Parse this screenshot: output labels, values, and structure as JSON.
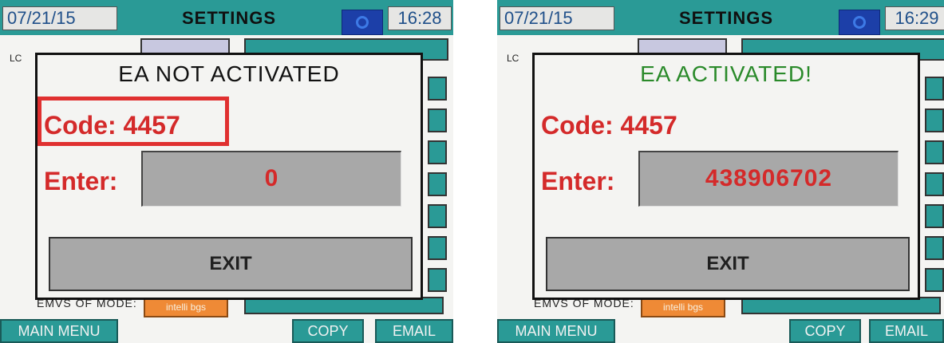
{
  "panels": [
    {
      "date": "07/21/15",
      "title": "SETTINGS",
      "time": "16:28",
      "dialog": {
        "status": "EA NOT ACTIVATED",
        "status_color": "#111111",
        "code_label": "Code: 4457",
        "enter_label": "Enter:",
        "enter_value": "0",
        "exit_label": "EXIT",
        "highlight": true
      },
      "background": {
        "mode_label": "EMVS OF MODE:",
        "mode_value": "intelli bgs"
      },
      "footer": {
        "main_menu": "MAIN MENU",
        "copy": "COPY",
        "email": "EMAIL"
      }
    },
    {
      "date": "07/21/15",
      "title": "SETTINGS",
      "time": "16:29",
      "dialog": {
        "status": "EA ACTIVATED!",
        "status_color": "#2a8a2a",
        "code_label": "Code: 4457",
        "enter_label": "Enter:",
        "enter_value": "438906702",
        "exit_label": "EXIT",
        "highlight": false
      },
      "background": {
        "mode_label": "EMVS OF MODE:",
        "mode_value": "intelli bgs"
      },
      "footer": {
        "main_menu": "MAIN MENU",
        "copy": "COPY",
        "email": "EMAIL"
      }
    }
  ],
  "colors": {
    "teal": "#2a9a96",
    "alert_red": "#d42a2a",
    "success_green": "#2a8a2a"
  },
  "icons": {
    "camera": "camera-icon"
  }
}
